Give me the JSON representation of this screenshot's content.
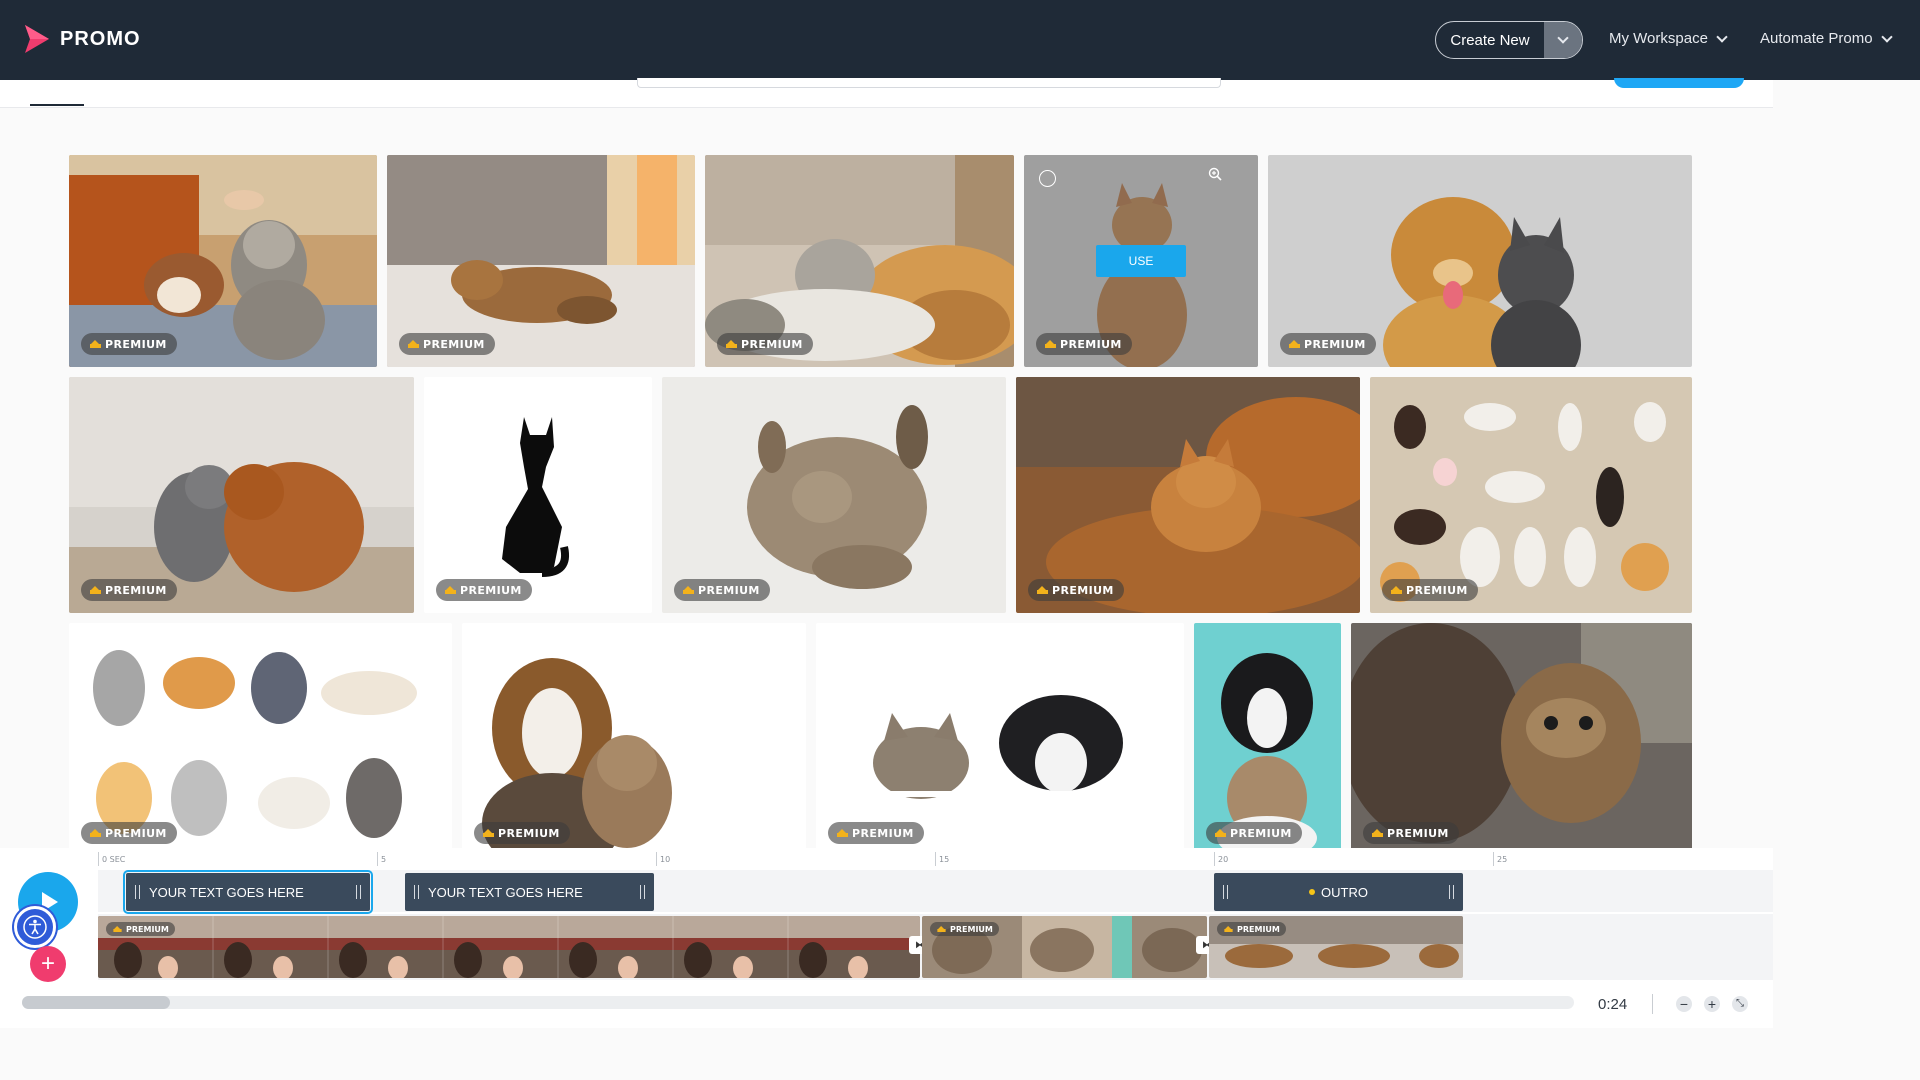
{
  "app": {
    "name": "PROMO",
    "brand_color": "#f03c6e",
    "accent": "#1aa7ec",
    "topbar_bg": "#1f2a37"
  },
  "topbar": {
    "create_new": "Create New",
    "workspace": "My Workspace",
    "automate": "Automate Promo"
  },
  "gallery": {
    "badge": "PREMIUM",
    "use_label": "USE",
    "tiles": [
      "cat-petted-with-dog",
      "cat-stretching-on-bed",
      "cat-and-dog-resting",
      "orange-cat-hovered",
      "golden-retriever-and-gray-cat",
      "gray-cat-and-spaniel",
      "black-cat-silhouette",
      "tabby-cat-sleeping",
      "orange-cat-on-bed",
      "illustrated-cats-pattern",
      "cartoon-cats-set",
      "shepherd-dog-and-cat",
      "cat-and-dog-peeking",
      "dog-and-cat-teal",
      "tabby-cat-closeup"
    ]
  },
  "timeline": {
    "ruler_labels": [
      "0 SEC",
      "5",
      "10",
      "15",
      "20",
      "25"
    ],
    "text_clips": [
      "YOUR TEXT GOES HERE",
      "YOUR TEXT GOES HERE",
      "OUTRO"
    ],
    "video_badge": "PREMIUM",
    "current_time": "0:24"
  },
  "icons": {
    "play": "play-icon",
    "accessibility": "accessibility-icon",
    "add": "plus-icon",
    "zoom_out": "zoom-out-icon",
    "zoom_in": "zoom-in-icon",
    "fullscreen": "collapse-icon"
  }
}
